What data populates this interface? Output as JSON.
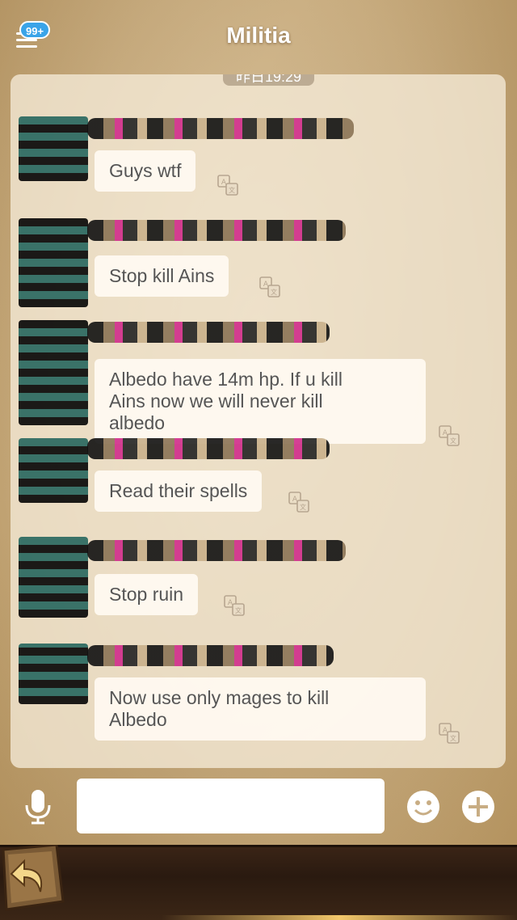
{
  "header": {
    "title": "Militia",
    "badge": "99+",
    "menu_icon": "menu-icon"
  },
  "chat": {
    "timestamp": "昨日19:29",
    "messages": [
      {
        "text": "Guys wtf"
      },
      {
        "text": "Stop kill Ains"
      },
      {
        "text": "Albedo have 14m hp. If u kill\nAins now we will never kill\nalbedo"
      },
      {
        "text": "Read their spells"
      },
      {
        "text": "Stop ruin"
      },
      {
        "text": "Now use only mages to kill\nAlbedo"
      }
    ]
  },
  "composer": {
    "input_value": "",
    "icons": {
      "mic": "microphone-icon",
      "emoji": "smiley-icon",
      "add": "plus-icon"
    }
  },
  "footer": {
    "back_icon": "back-arrow-icon"
  },
  "colors": {
    "badge": "#3aa4e8",
    "bubble": "#fffaf2",
    "text": "#555555"
  }
}
